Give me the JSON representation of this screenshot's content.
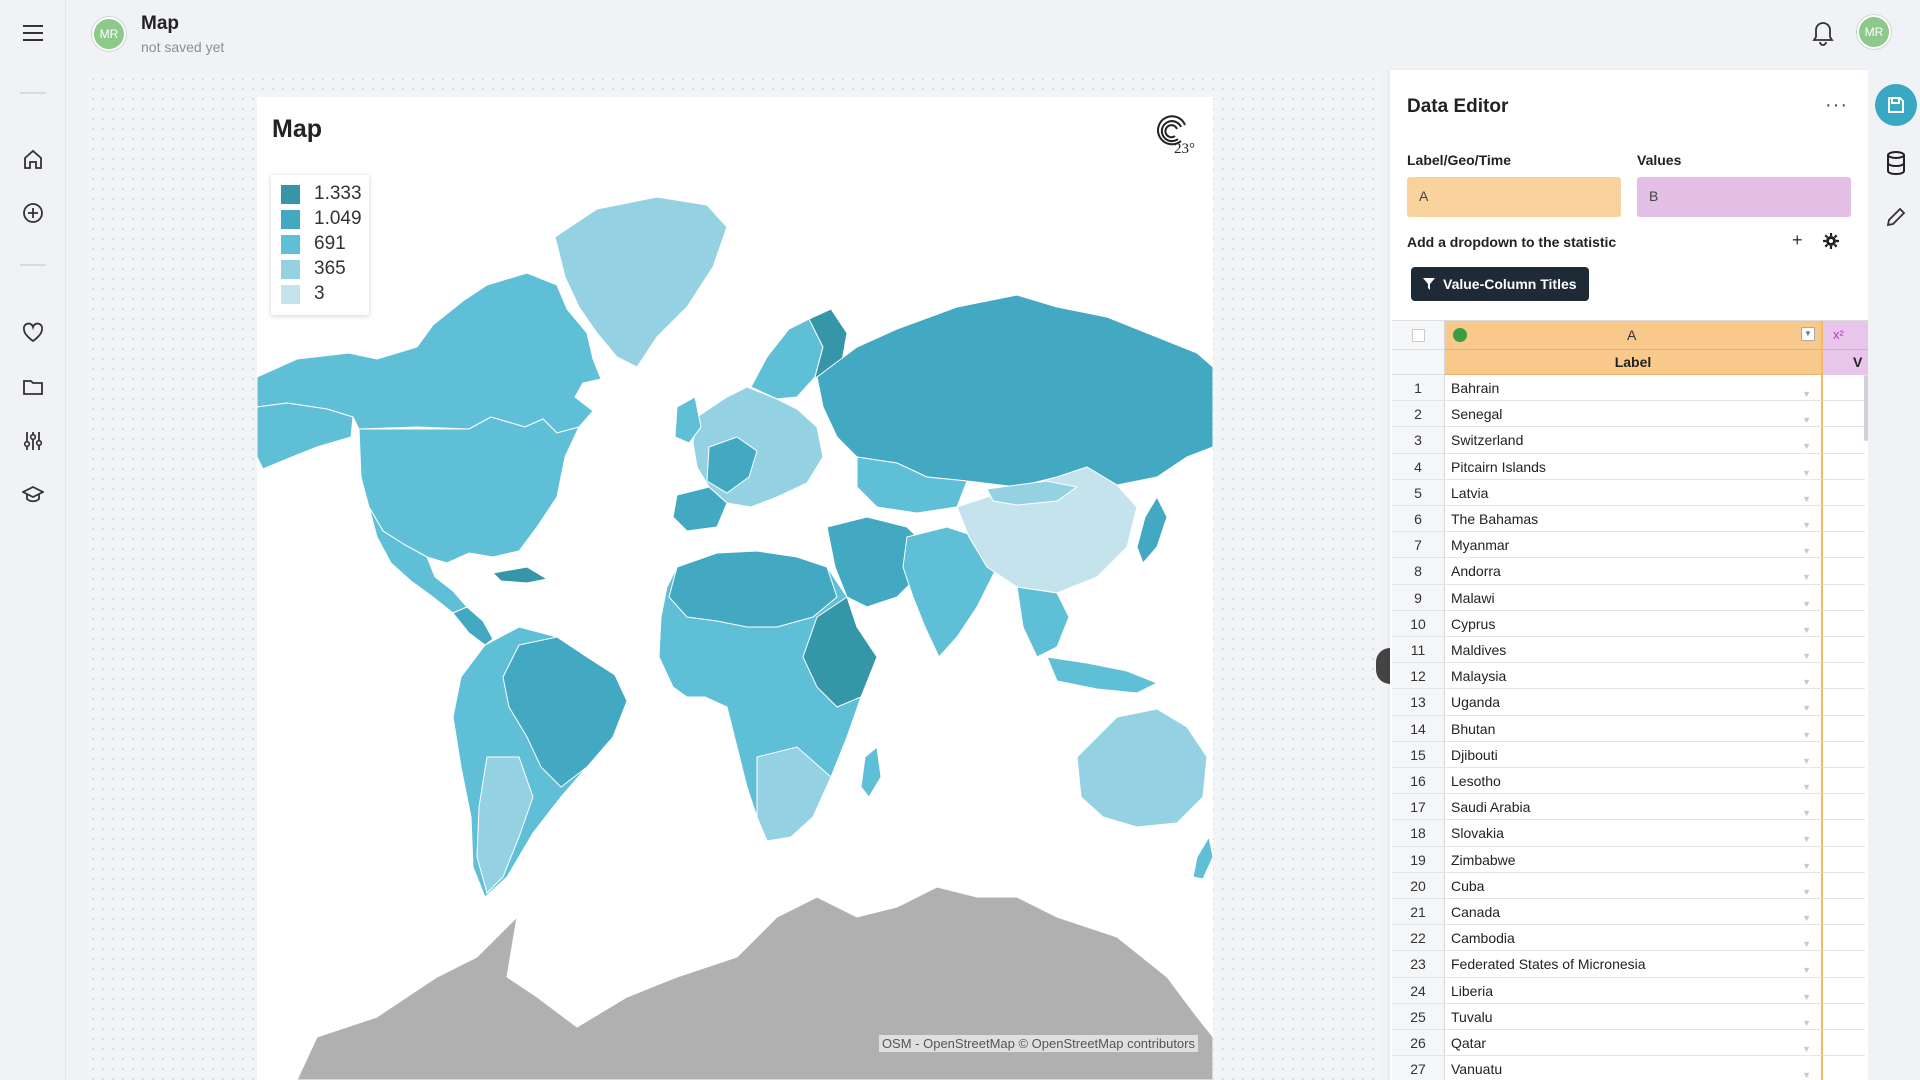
{
  "header": {
    "title": "Map",
    "subtitle": "not saved yet",
    "avatar": "MR",
    "user_avatar": "MR"
  },
  "map": {
    "title": "Map",
    "logo_text": "23°",
    "attribution": "OSM - OpenStreetMap  © OpenStreetMap contributors",
    "legend": [
      {
        "label": "1.333",
        "color": "#3596a8"
      },
      {
        "label": "1.049",
        "color": "#43a9c2"
      },
      {
        "label": "691",
        "color": "#5fbfd6"
      },
      {
        "label": "365",
        "color": "#94d2e3"
      },
      {
        "label": "3",
        "color": "#c5e3ec"
      }
    ]
  },
  "editor": {
    "title": "Data Editor",
    "more": "···",
    "label_field": {
      "label": "Label/Geo/Time",
      "value": "A"
    },
    "values_field": {
      "label": "Values",
      "value": "B"
    },
    "dropdown_label": "Add a dropdown to the statistic",
    "plus": "+",
    "chip": "Value-Column Titles",
    "grid": {
      "col_a": "A",
      "col_a_sub": "Label",
      "col_b_icon": "x²",
      "col_b_sub": "V",
      "rows": [
        "Bahrain",
        "Senegal",
        "Switzerland",
        "Pitcairn Islands",
        "Latvia",
        "The Bahamas",
        "Myanmar",
        "Andorra",
        "Malawi",
        "Cyprus",
        "Maldives",
        "Malaysia",
        "Uganda",
        "Bhutan",
        "Djibouti",
        "Lesotho",
        "Saudi Arabia",
        "Slovakia",
        "Zimbabwe",
        "Cuba",
        "Canada",
        "Cambodia",
        "Federated States of Micronesia",
        "Liberia",
        "Tuvalu",
        "Qatar",
        "Vanuatu"
      ]
    }
  },
  "colors": {
    "accent": "#3aa8c4",
    "label_field": "#fad29d",
    "values_field": "#e3bfe6",
    "antarctica": "#b0b0b0"
  }
}
